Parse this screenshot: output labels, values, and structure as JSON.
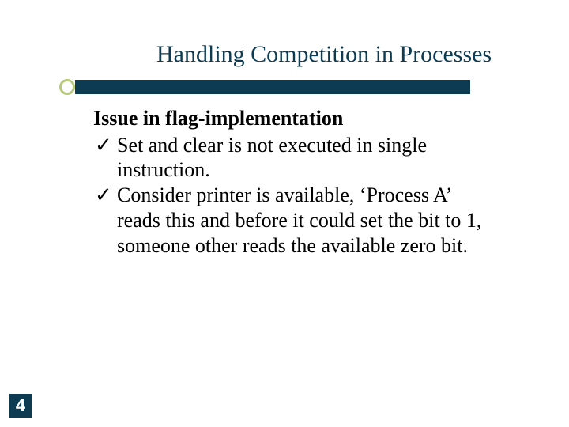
{
  "slide": {
    "title": "Handling Competition in Processes",
    "subtitle": "Issue in flag-implementation",
    "bullets": [
      "Set and clear is not executed in single instruction.",
      "Consider printer is available, ‘Process A’ reads this and before it could set the bit to 1, someone other reads the available zero bit."
    ],
    "page_number": "4",
    "accent_color": "#0d3b52",
    "bullet_color": "#b7c97a",
    "check_glyph": "✓"
  }
}
